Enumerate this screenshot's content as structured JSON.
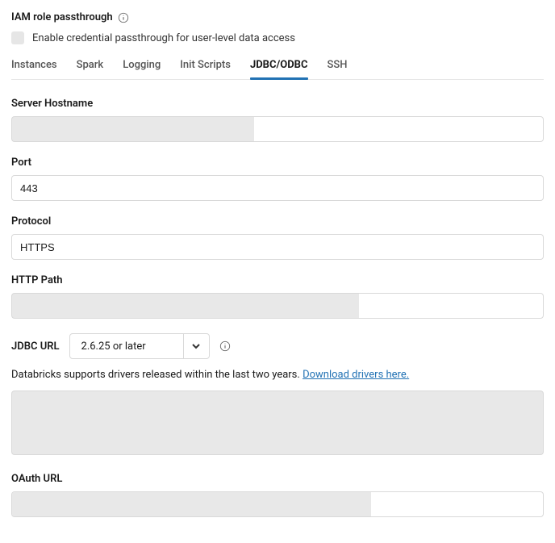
{
  "iam": {
    "title": "IAM role passthrough",
    "checkbox_label": "Enable credential passthrough for user-level data access"
  },
  "tabs": {
    "items": [
      "Instances",
      "Spark",
      "Logging",
      "Init Scripts",
      "JDBC/ODBC",
      "SSH"
    ],
    "active_index": 4
  },
  "fields": {
    "server_hostname": {
      "label": "Server Hostname",
      "value": ""
    },
    "port": {
      "label": "Port",
      "value": "443"
    },
    "protocol": {
      "label": "Protocol",
      "value": "HTTPS"
    },
    "http_path": {
      "label": "HTTP Path",
      "value": ""
    },
    "jdbc_url": {
      "label": "JDBC URL",
      "selected": "2.6.25 or later"
    },
    "oauth_url": {
      "label": "OAuth URL"
    }
  },
  "helper": {
    "text": "Databricks supports drivers released within the last two years. ",
    "link_text": "Download drivers here."
  }
}
